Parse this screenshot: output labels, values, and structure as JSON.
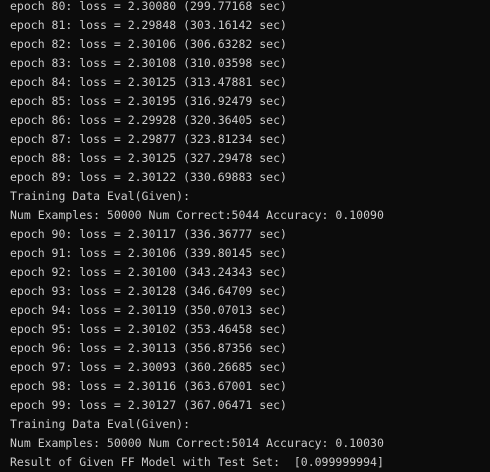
{
  "terminal": {
    "lines": [
      "epoch 80: loss = 2.30080 (299.77168 sec)",
      "epoch 81: loss = 2.29848 (303.16142 sec)",
      "epoch 82: loss = 2.30106 (306.63282 sec)",
      "epoch 83: loss = 2.30108 (310.03598 sec)",
      "epoch 84: loss = 2.30125 (313.47881 sec)",
      "epoch 85: loss = 2.30195 (316.92479 sec)",
      "epoch 86: loss = 2.29928 (320.36405 sec)",
      "epoch 87: loss = 2.29877 (323.81234 sec)",
      "epoch 88: loss = 2.30125 (327.29478 sec)",
      "epoch 89: loss = 2.30122 (330.69883 sec)",
      "Training Data Eval(Given):",
      "Num Examples: 50000 Num Correct:5044 Accuracy: 0.10090",
      "epoch 90: loss = 2.30117 (336.36777 sec)",
      "epoch 91: loss = 2.30106 (339.80145 sec)",
      "epoch 92: loss = 2.30100 (343.24343 sec)",
      "epoch 93: loss = 2.30128 (346.64709 sec)",
      "epoch 94: loss = 2.30119 (350.07013 sec)",
      "epoch 95: loss = 2.30102 (353.46458 sec)",
      "epoch 96: loss = 2.30113 (356.87356 sec)",
      "epoch 97: loss = 2.30093 (360.26685 sec)",
      "epoch 98: loss = 2.30116 (363.67001 sec)",
      "epoch 99: loss = 2.30127 (367.06471 sec)",
      "Training Data Eval(Given):",
      "Num Examples: 50000 Num Correct:5014 Accuracy: 0.10030",
      "Result of Given FF Model with Test Set:  [0.099999994]"
    ]
  },
  "colors": {
    "background": "#0c0c0c",
    "text": "#cccccc"
  }
}
